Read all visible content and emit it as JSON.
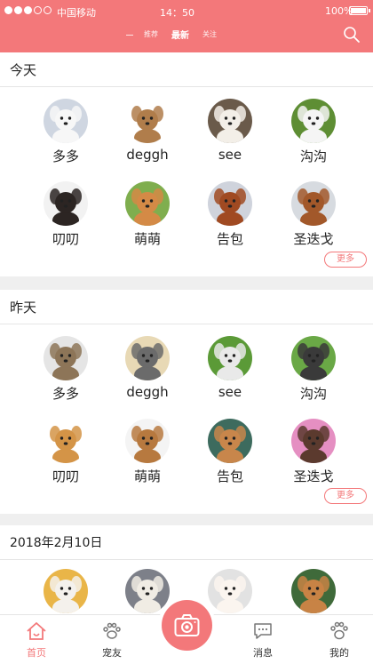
{
  "status_bar": {
    "carrier": "中国移动",
    "time": "14：50",
    "battery_text": "100%",
    "battery_level": 1.0
  },
  "header": {
    "tabs": [
      {
        "label": "推荐",
        "active": false
      },
      {
        "label": "最新",
        "active": true
      },
      {
        "label": "关注",
        "active": false
      }
    ],
    "search_icon": "search-icon"
  },
  "sections": [
    {
      "title": "今天",
      "more_label": "更多",
      "pets": [
        {
          "name": "多多",
          "bg": "#cfd6e1",
          "fur": "#f7f7f7"
        },
        {
          "name": "deggh",
          "bg": "#ffffff",
          "fur": "#b07d4b"
        },
        {
          "name": "see",
          "bg": "#6a5a4a",
          "fur": "#f3efe8"
        },
        {
          "name": "沟沟",
          "bg": "#5e8e34",
          "fur": "#f5f5f5"
        },
        {
          "name": "叨叨",
          "bg": "#f2f2f2",
          "fur": "#2c2523"
        },
        {
          "name": "萌萌",
          "bg": "#7fae4e",
          "fur": "#d48a46"
        },
        {
          "name": "告包",
          "bg": "#cfd3dc",
          "fur": "#a04a22"
        },
        {
          "name": "圣迭戈",
          "bg": "#d7dbe0",
          "fur": "#a2582a"
        }
      ]
    },
    {
      "title": "昨天",
      "more_label": "更多",
      "pets": [
        {
          "name": "多多",
          "bg": "#e5e5e5",
          "fur": "#8d7558"
        },
        {
          "name": "deggh",
          "bg": "#e8d9b5",
          "fur": "#6b6b6b"
        },
        {
          "name": "see",
          "bg": "#5b9a37",
          "fur": "#e9e9e9"
        },
        {
          "name": "沟沟",
          "bg": "#6aa846",
          "fur": "#3a3a3a"
        },
        {
          "name": "叨叨",
          "bg": "#ffffff",
          "fur": "#d49447"
        },
        {
          "name": "萌萌",
          "bg": "#f4f4f4",
          "fur": "#b7793f"
        },
        {
          "name": "告包",
          "bg": "#3d6b5e",
          "fur": "#c8864b"
        },
        {
          "name": "圣迭戈",
          "bg": "#e58fc2",
          "fur": "#5b3a2e"
        }
      ]
    },
    {
      "title": "2018年2月10日",
      "pets": [
        {
          "name": "",
          "bg": "#e9b548",
          "fur": "#f4f1ec"
        },
        {
          "name": "",
          "bg": "#7d8089",
          "fur": "#f0ece4"
        },
        {
          "name": "",
          "bg": "#e2e2e2",
          "fur": "#fbf5ef"
        },
        {
          "name": "",
          "bg": "#3f6a3a",
          "fur": "#c88345"
        }
      ]
    }
  ],
  "bottom_nav": [
    {
      "label": "首页",
      "icon": "home-icon",
      "active": true
    },
    {
      "label": "宠友",
      "icon": "paw-icon",
      "active": false
    },
    {
      "label": "消息",
      "icon": "chat-icon",
      "active": false
    },
    {
      "label": "我的",
      "icon": "paw-profile-icon",
      "active": false
    }
  ],
  "camera_icon": "camera-icon",
  "colors": {
    "accent": "#f3787a",
    "background": "#efefef"
  }
}
